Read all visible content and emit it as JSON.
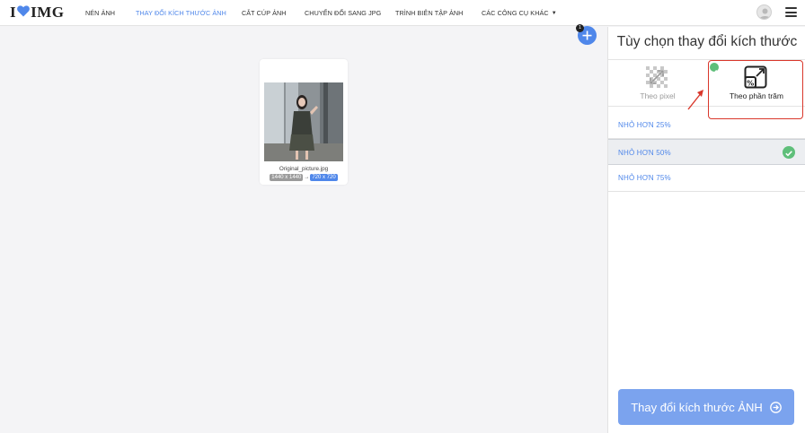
{
  "header": {
    "logo": {
      "text_left": "I",
      "text_right": "IMG",
      "heart_color": "#4f87ea"
    },
    "nav": [
      {
        "label": "NÉN ẢNH",
        "active": false
      },
      {
        "label": "THAY ĐỔI KÍCH THƯỚC ẢNH",
        "active": true
      },
      {
        "label": "CẮT CÚP ẢNH",
        "active": false
      },
      {
        "label": "CHUYỂN ĐỔI SANG JPG",
        "active": false
      },
      {
        "label": "TRÌNH BIÊN TẬP ẢNH",
        "active": false
      },
      {
        "label": "CÁC CÔNG CỤ KHÁC",
        "active": false,
        "has_dropdown": true
      }
    ],
    "avatar_icon": "user-avatar-icon",
    "menu_icon": "hamburger-menu-icon"
  },
  "workspace": {
    "file": {
      "name": "Original_picture.jpg",
      "original_size": "1440 x 1440",
      "new_size": "720 x 720"
    },
    "add_button": {
      "icon": "plus-icon",
      "badge": "1"
    }
  },
  "sidebar": {
    "title": "Tùy chọn thay đổi kích thước",
    "modes": [
      {
        "label": "Theo pixel",
        "icon": "pixel-resize-icon",
        "selected": false
      },
      {
        "label": "Theo phần trăm",
        "icon": "percent-resize-icon",
        "selected": true
      }
    ],
    "options": [
      {
        "label": "NHỎ HƠN 25%",
        "selected": false
      },
      {
        "label": "NHỎ HƠN 50%",
        "selected": true
      },
      {
        "label": "NHỎ HƠN 75%",
        "selected": false
      }
    ],
    "submit": {
      "label": "Thay đổi kích thước ẢNH",
      "icon": "arrow-right-circle-icon"
    }
  },
  "colors": {
    "accent": "#4f87ea",
    "button": "#7ba3ee",
    "check": "#5fbf7a",
    "annotation": "#d9372b"
  }
}
